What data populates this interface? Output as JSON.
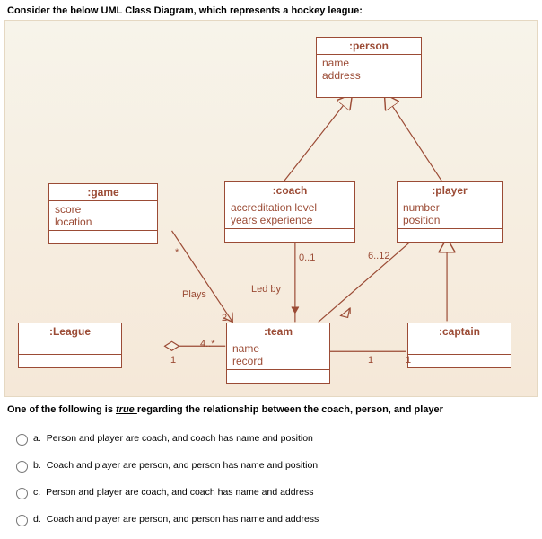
{
  "prompt_text": "Consider the below UML Class Diagram, which represents a hockey league:",
  "diagram": {
    "person": {
      "title": ":person",
      "attrs": "name\naddress"
    },
    "game": {
      "title": ":game",
      "attrs": "score\nlocation"
    },
    "coach": {
      "title": ":coach",
      "attrs": "accreditation level\nyears experience"
    },
    "player": {
      "title": ":player",
      "attrs": "number\nposition"
    },
    "league": {
      "title": ":League",
      "attrs": ""
    },
    "team": {
      "title": ":team",
      "attrs": "name\nrecord"
    },
    "captain": {
      "title": ":captain",
      "attrs": ""
    },
    "labels": {
      "plays": "Plays",
      "ledby": "Led by",
      "m_0_1": "0..1",
      "m_6_12": "6..12",
      "m_2": "2",
      "m_4s": "4..*",
      "m_star": "*",
      "m_1a": "1",
      "m_1b": "1",
      "m_1c": "1",
      "m_1d": "1"
    }
  },
  "question_prefix": "One of the following is ",
  "question_true": "true ",
  "question_suffix": "regarding the relationship between the coach, person, and player",
  "options": {
    "a": {
      "label": "a.",
      "text": "Person and player are coach, and coach has name and position"
    },
    "b": {
      "label": "b.",
      "text": "Coach and player are person, and person has name and position"
    },
    "c": {
      "label": "c.",
      "text": "Person and player are coach, and coach has name and address"
    },
    "d": {
      "label": "d.",
      "text": "Coach and player are person, and person has name and address"
    }
  }
}
